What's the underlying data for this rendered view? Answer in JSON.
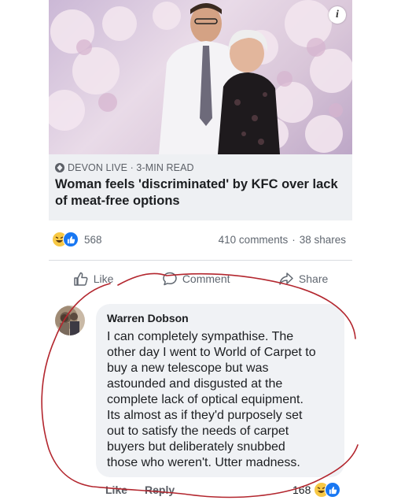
{
  "post": {
    "info_icon": "i",
    "source": "DEVON LIVE · 3-MIN READ",
    "headline": "Woman feels 'discriminated' by KFC over lack of meat-free options",
    "reaction_count": "568",
    "comments": "410 comments",
    "separator": "·",
    "shares": "38 shares"
  },
  "actions": {
    "like": "Like",
    "comment": "Comment",
    "share": "Share"
  },
  "comment": {
    "author": "Warren Dobson",
    "lines": [
      "I can completely sympathise. The",
      "other day I went to World of Carpet to",
      "buy a new telescope but was",
      "astounded and disgusted at the",
      "complete lack of optical equipment.",
      "Its almost as if they'd purposely set",
      "out to satisfy the needs of carpet",
      "buyers but deliberately snubbed",
      "those who weren't. Utter madness."
    ],
    "like_label": "Like",
    "reply_label": "Reply",
    "reaction_count": "168"
  },
  "colors": {
    "facebook_blue": "#1877f2",
    "haha_yellow": "#f7c844",
    "annotation_red": "#b3262e"
  }
}
